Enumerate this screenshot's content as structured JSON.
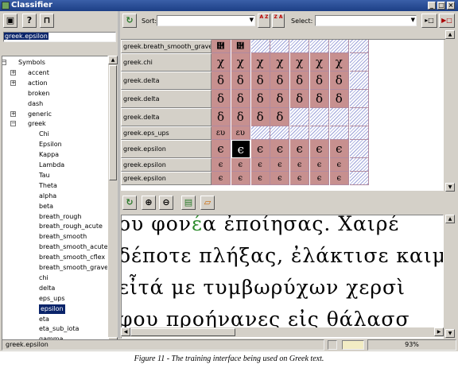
{
  "window": {
    "title": "Classifier"
  },
  "left_panel": {
    "search_value": "greek.epsilon",
    "tree": [
      {
        "label": "Symbols",
        "level": 0,
        "expander": "-"
      },
      {
        "label": "accent",
        "level": 1,
        "expander": "+"
      },
      {
        "label": "action",
        "level": 1,
        "expander": "+"
      },
      {
        "label": "broken",
        "level": 1,
        "expander": ""
      },
      {
        "label": "dash",
        "level": 1,
        "expander": ""
      },
      {
        "label": "generic",
        "level": 1,
        "expander": "+"
      },
      {
        "label": "greek",
        "level": 1,
        "expander": "-"
      },
      {
        "label": "Chi",
        "level": 2,
        "expander": ""
      },
      {
        "label": "Epsilon",
        "level": 2,
        "expander": ""
      },
      {
        "label": "Kappa",
        "level": 2,
        "expander": ""
      },
      {
        "label": "Lambda",
        "level": 2,
        "expander": ""
      },
      {
        "label": "Tau",
        "level": 2,
        "expander": ""
      },
      {
        "label": "Theta",
        "level": 2,
        "expander": ""
      },
      {
        "label": "alpha",
        "level": 2,
        "expander": ""
      },
      {
        "label": "beta",
        "level": 2,
        "expander": ""
      },
      {
        "label": "breath_rough",
        "level": 2,
        "expander": ""
      },
      {
        "label": "breath_rough_acute",
        "level": 2,
        "expander": ""
      },
      {
        "label": "breath_smooth",
        "level": 2,
        "expander": ""
      },
      {
        "label": "breath_smooth_acute",
        "level": 2,
        "expander": ""
      },
      {
        "label": "breath_smooth_cflex",
        "level": 2,
        "expander": ""
      },
      {
        "label": "breath_smooth_grave",
        "level": 2,
        "expander": ""
      },
      {
        "label": "chi",
        "level": 2,
        "expander": ""
      },
      {
        "label": "delta",
        "level": 2,
        "expander": ""
      },
      {
        "label": "eps_ups",
        "level": 2,
        "expander": ""
      },
      {
        "label": "epsilon",
        "level": 2,
        "expander": "",
        "selected": true
      },
      {
        "label": "eta",
        "level": 2,
        "expander": ""
      },
      {
        "label": "eta_sub_iota",
        "level": 2,
        "expander": ""
      },
      {
        "label": "gamma",
        "level": 2,
        "expander": ""
      }
    ]
  },
  "toolbar": {
    "sort_label": "Sort:",
    "select_label": "Select:",
    "sort_az_label": "A Z",
    "sort_za_label": "Z A",
    "sort_value": "",
    "select_value": ""
  },
  "grid_rows": [
    {
      "label": "greek.breath_smooth_grave",
      "glyph": "὾",
      "filled": 2,
      "short": true
    },
    {
      "label": "greek.chi",
      "glyph": "χ",
      "filled": 7
    },
    {
      "label": "greek.delta",
      "glyph": "δ",
      "filled": 7
    },
    {
      "label": "greek.delta",
      "glyph": "δ",
      "filled": 7
    },
    {
      "label": "greek.delta",
      "glyph": "δ",
      "filled": 4
    },
    {
      "label": "greek.eps_ups",
      "glyph": "ευ",
      "filled": 2,
      "short": true
    },
    {
      "label": "greek.epsilon",
      "glyph": "ϵ",
      "filled": 7,
      "highlight": 1
    },
    {
      "label": "greek.epsilon",
      "glyph": "ϵ",
      "filled": 7,
      "short": true
    },
    {
      "label": "greek.epsilon",
      "glyph": "ϵ",
      "filled": 7,
      "short": true
    }
  ],
  "scan_lines": [
    {
      "text": "ου φον",
      "green": "έ",
      "rest": "α ἐποίησας. Χαιρέ"
    },
    {
      "text": "δέποτε πλήξας, ἐλάκτισε καιμ",
      "green": "",
      "rest": ""
    },
    {
      "text": "εἶτά με τυμβωρύχων χερσὶ",
      "green": "",
      "rest": ""
    },
    {
      "text": "φου προήνανες εἰς θάλασσ",
      "green": "",
      "rest": ""
    }
  ],
  "status": {
    "text": "greek.epsilon",
    "zoom": "93%"
  },
  "caption": "Figure 11 - The training interface being used on Greek text.",
  "icons": [
    "floppy-icon",
    "help-icon",
    "lock-icon",
    "refresh-icon",
    "sort-az-icon",
    "sort-za-icon",
    "zoom-in-icon",
    "zoom-out-icon",
    "classify-icon",
    "open-icon"
  ]
}
